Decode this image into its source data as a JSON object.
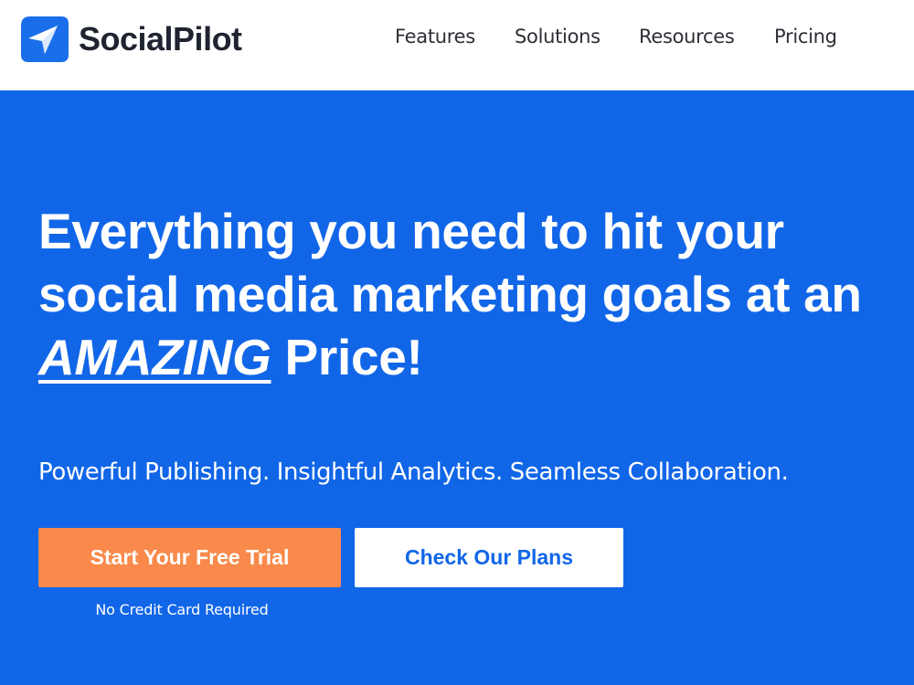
{
  "brand": {
    "name": "SocialPilot",
    "accent_color": "#1166e8",
    "logo_icon": "paper-plane-icon"
  },
  "nav": {
    "items": [
      {
        "label": "Features"
      },
      {
        "label": "Solutions"
      },
      {
        "label": "Resources"
      },
      {
        "label": "Pricing"
      }
    ]
  },
  "hero": {
    "headline_part1": "Everything you need to hit your social media marketing goals at an ",
    "headline_emphasis": "AMAZING",
    "headline_part2": " Price!",
    "subheadline": "Powerful Publishing. Insightful Analytics. Seamless Collaboration.",
    "primary_cta": "Start Your Free Trial",
    "secondary_cta": "Check Our Plans",
    "cta_note": "No Credit Card Required",
    "primary_cta_color": "#f98a4b"
  }
}
